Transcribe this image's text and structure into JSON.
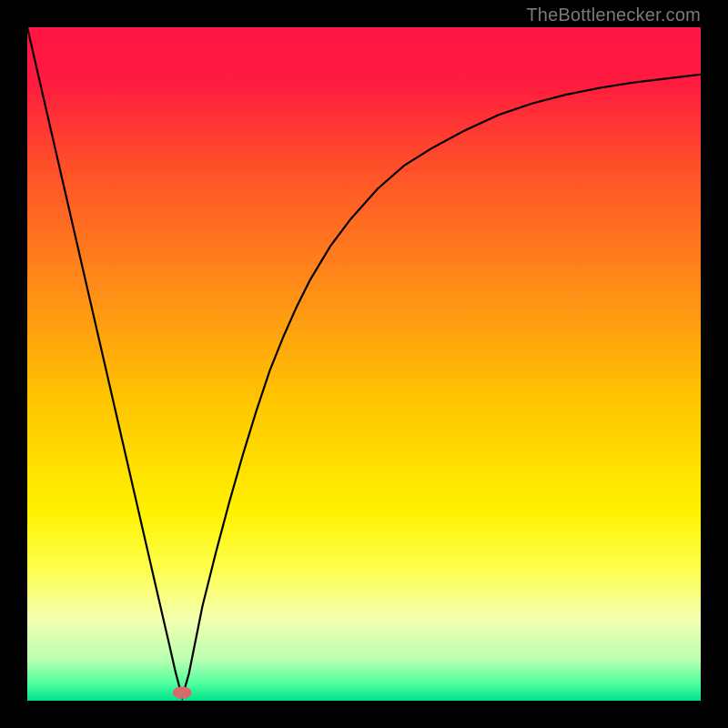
{
  "attribution": "TheBottlenecker.com",
  "chart_data": {
    "type": "line",
    "title": "",
    "xlabel": "",
    "ylabel": "",
    "xlim": [
      0,
      100
    ],
    "ylim": [
      0,
      100
    ],
    "background_gradient": {
      "stops": [
        {
          "offset": 0.0,
          "color": "#ff1645"
        },
        {
          "offset": 0.08,
          "color": "#ff1a3f"
        },
        {
          "offset": 0.2,
          "color": "#ff4d2a"
        },
        {
          "offset": 0.38,
          "color": "#ff8a18"
        },
        {
          "offset": 0.55,
          "color": "#ffc400"
        },
        {
          "offset": 0.72,
          "color": "#fff200"
        },
        {
          "offset": 0.8,
          "color": "#feff4a"
        },
        {
          "offset": 0.88,
          "color": "#f4ffb0"
        },
        {
          "offset": 0.94,
          "color": "#b8ffb0"
        },
        {
          "offset": 0.975,
          "color": "#4dff9e"
        },
        {
          "offset": 1.0,
          "color": "#00e28a"
        }
      ]
    },
    "marker": {
      "x": 23,
      "y": 1.2,
      "rx": 1.4,
      "ry": 0.9,
      "color": "#d86a6a"
    },
    "series": [
      {
        "name": "curve",
        "color": "#000000",
        "x": [
          0,
          2,
          4,
          6,
          8,
          10,
          12,
          14,
          16,
          18,
          20,
          21,
          22,
          23,
          24,
          25,
          26,
          28,
          30,
          32,
          34,
          36,
          38,
          40,
          42,
          45,
          48,
          52,
          56,
          60,
          65,
          70,
          75,
          80,
          85,
          90,
          95,
          100
        ],
        "values": [
          100,
          91.3,
          82.6,
          73.9,
          65.2,
          56.5,
          47.8,
          39.1,
          30.4,
          21.7,
          13.0,
          8.7,
          4.3,
          0.5,
          4.0,
          9.0,
          14.0,
          22.0,
          29.5,
          36.5,
          43.0,
          49.0,
          54.0,
          58.5,
          62.5,
          67.5,
          71.5,
          76.0,
          79.5,
          82.0,
          84.7,
          87.0,
          88.7,
          90.0,
          91.0,
          91.8,
          92.4,
          93.0
        ]
      }
    ]
  }
}
